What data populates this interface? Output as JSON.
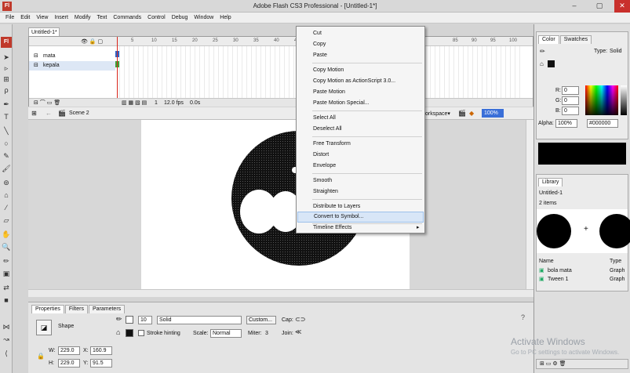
{
  "window": {
    "title": "Adobe Flash CS3 Professional - [Untitled-1*]",
    "app_icon": "Fl",
    "minimize": "–",
    "maximize": "▢",
    "close": "✕"
  },
  "menubar": [
    "File",
    "Edit",
    "View",
    "Insert",
    "Modify",
    "Text",
    "Commands",
    "Control",
    "Debug",
    "Window",
    "Help"
  ],
  "tools": {
    "logo": "Fl"
  },
  "document": {
    "tab": "Untitled-1*",
    "scene": "Scene 2",
    "workspace": "orkspace▾",
    "zoom": "100%"
  },
  "timeline": {
    "layers": [
      {
        "name": "mata"
      },
      {
        "name": "kepala"
      }
    ],
    "frame_numbers": [
      "5",
      "10",
      "15",
      "20",
      "25",
      "30",
      "35",
      "40",
      "45",
      "85",
      "90",
      "95",
      "100"
    ],
    "footer": {
      "frame": "1",
      "fps": "12.0 fps",
      "time": "0.0s"
    }
  },
  "context_menu": {
    "items": [
      "Cut",
      "Copy",
      "Paste",
      "Copy Motion",
      "Copy Motion as ActionScript 3.0...",
      "Paste Motion",
      "Paste Motion Special...",
      "Select All",
      "Deselect All",
      "Free Transform",
      "Distort",
      "Envelope",
      "Smooth",
      "Straighten",
      "Distribute to Layers",
      "Convert to Symbol...",
      "Timeline Effects"
    ],
    "highlighted": "Convert to Symbol...",
    "submenu_arrow": "▸"
  },
  "properties": {
    "tabs": [
      "Properties",
      "Filters",
      "Parameters"
    ],
    "object_type": "Shape",
    "stroke_size": "10",
    "stroke_style": "Solid",
    "custom_button": "Custom...",
    "cap_label": "Cap:",
    "stroke_hinting": "Stroke hinting",
    "scale_label": "Scale:",
    "scale_value": "Normal",
    "miter_label": "Miter:",
    "miter_value": "3",
    "join_label": "Join:",
    "w_label": "W:",
    "w": "229.0",
    "x_label": "X:",
    "x": "160.9",
    "h_label": "H:",
    "h": "229.0",
    "y_label": "Y:",
    "y": "91.5"
  },
  "color_panel": {
    "tabs": [
      "Color",
      "Swatches"
    ],
    "type_label": "Type:",
    "type_value": "Solid",
    "r_label": "R:",
    "r": "0",
    "g_label": "G:",
    "g": "0",
    "b_label": "B:",
    "b": "0",
    "alpha_label": "Alpha:",
    "alpha": "100%",
    "hex": "#000000"
  },
  "library_panel": {
    "tab": "Library",
    "document": "Untitled-1",
    "count": "2 items",
    "col_name": "Name",
    "col_type": "Type",
    "items": [
      {
        "name": "bola mata",
        "type": "Graph"
      },
      {
        "name": "Tween 1",
        "type": "Graph"
      }
    ]
  },
  "watermark": {
    "line1": "Activate Windows",
    "line2": "Go to PC settings to activate Windows."
  },
  "colors": {
    "accent_red": "#c0392b",
    "highlight": "#d8e6f7",
    "shape_fill": "#111111"
  }
}
